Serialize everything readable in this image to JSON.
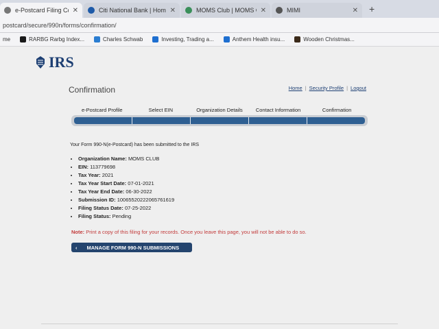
{
  "browser": {
    "tabs": [
      {
        "title": "e-Postcard Filing Confirmation",
        "active": true
      },
      {
        "title": "Citi National Bank | Home",
        "active": false
      },
      {
        "title": "MOMS Club | MOMS Offering M",
        "active": false
      },
      {
        "title": "MIMI",
        "active": false
      }
    ],
    "new_tab": "+",
    "url": "postcard/secure/990n/forms/confirmation/",
    "bookmarks": [
      {
        "label": "me",
        "color": "#666666"
      },
      {
        "label": "RARBG Rarbg Index...",
        "color": "#1a1a1a"
      },
      {
        "label": "Charles Schwab",
        "color": "#2a7dd1"
      },
      {
        "label": "Investing, Trading a...",
        "color": "#1e6fd0"
      },
      {
        "label": "Anthem Health insu...",
        "color": "#1e6fd0"
      },
      {
        "label": "Wooden Christmas...",
        "color": "#3b2a1a"
      }
    ]
  },
  "header": {
    "logo_text": "IRS",
    "page_title": "Confirmation",
    "links": [
      "Home",
      "Security Profile",
      "Logout"
    ]
  },
  "steps": [
    "e-Postcard Profile",
    "Select EIN",
    "Organization Details",
    "Contact Information",
    "Confirmation"
  ],
  "main": {
    "intro": "Your Form 990-N(e-Postcard) has been submitted to the IRS",
    "details": [
      {
        "label": "Organization Name:",
        "value": "MOMS CLUB"
      },
      {
        "label": "EIN:",
        "value": "113779698"
      },
      {
        "label": "Tax Year:",
        "value": "2021"
      },
      {
        "label": "Tax Year Start Date:",
        "value": "07-01-2021"
      },
      {
        "label": "Tax Year End Date:",
        "value": "06-30-2022"
      },
      {
        "label": "Submission ID:",
        "value": "10065520222065761619"
      },
      {
        "label": "Filing Status Date:",
        "value": "07-25-2022"
      },
      {
        "label": "Filing Status:",
        "value": "Pending"
      }
    ],
    "note_label": "Note:",
    "note_text": "Print a copy of this filing for your records. Once you leave this page, you will not be able to do so.",
    "button_arrow": "‹",
    "button_label": "MANAGE FORM 990-N SUBMISSIONS"
  },
  "colors": {
    "irs_blue": "#1d3f73",
    "progress_blue": "#2e5f92",
    "note_red": "#c23a3a",
    "button_bg": "#24446e"
  }
}
